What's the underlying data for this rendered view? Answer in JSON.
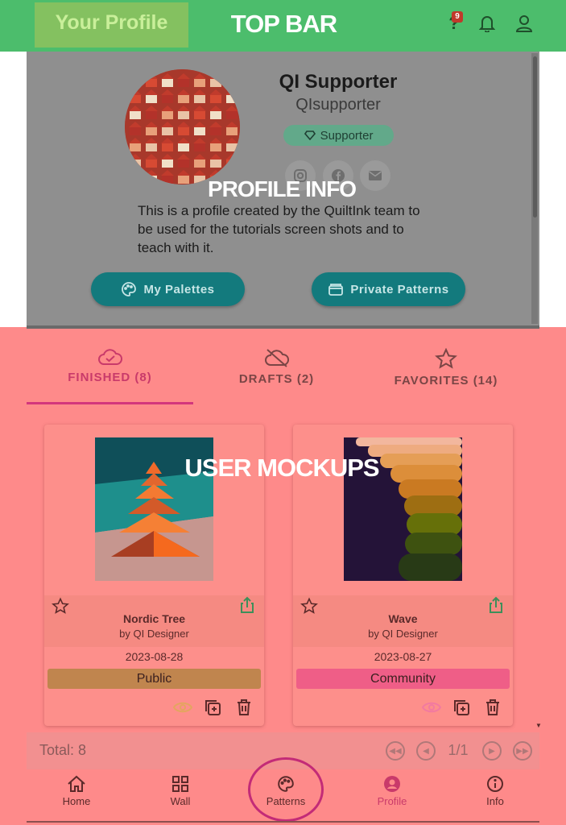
{
  "topbar": {
    "title": "Your Profile",
    "region_label": "TOP BAR",
    "help_icon": "help-icon",
    "help_badge": "9",
    "notifications_icon": "bell-icon",
    "account_icon": "user-icon",
    "accent_color": "#4cbd6c"
  },
  "profile": {
    "region_label": "PROFILE INFO",
    "display_name": "QI Supporter",
    "username": "QIsupporter",
    "badge": "Supporter",
    "badge_icon": "diamond-icon",
    "socials": [
      "instagram-icon",
      "facebook-icon",
      "email-icon"
    ],
    "bio": "This is a profile created by the QuiltInk team to be used for the tutorials screen shots and to teach with it.",
    "buttons": {
      "palettes": "My Palettes",
      "private": "Private Patterns"
    }
  },
  "mockups": {
    "region_label": "USER MOCKUPS",
    "tabs": [
      {
        "label": "FINISHED (8)",
        "icon": "cloud-check-icon",
        "active": true
      },
      {
        "label": "DRAFTS (2)",
        "icon": "cloud-off-icon",
        "active": false
      },
      {
        "label": "FAVORITES (14)",
        "icon": "star-outline-icon",
        "active": false
      }
    ],
    "cards": [
      {
        "title": "Nordic Tree",
        "author": "by QI Designer",
        "date": "2023-08-28",
        "visibility": "Public",
        "visibility_color": "#c0854e"
      },
      {
        "title": "Wave",
        "author": "by QI Designer",
        "date": "2023-08-27",
        "visibility": "Community",
        "visibility_color": "#ef5e87"
      }
    ],
    "total": "Total: 8",
    "page": "1/1"
  },
  "bottom_nav": [
    {
      "label": "Home",
      "icon": "home-icon"
    },
    {
      "label": "Wall",
      "icon": "grid-icon"
    },
    {
      "label": "Patterns",
      "icon": "palette-icon"
    },
    {
      "label": "Profile",
      "icon": "account-circle-icon",
      "active": true
    },
    {
      "label": "Info",
      "icon": "info-icon"
    }
  ]
}
